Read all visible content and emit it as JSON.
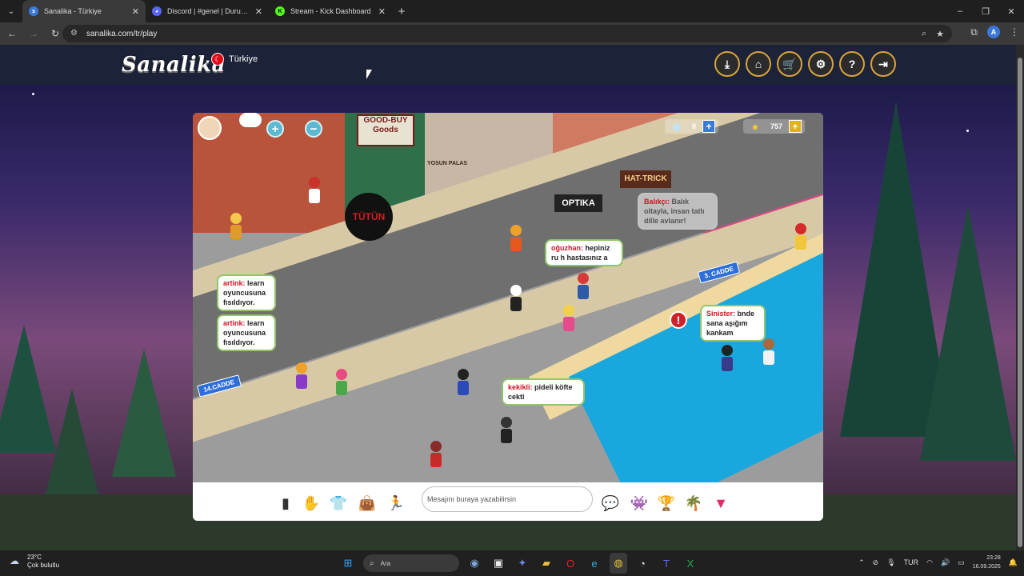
{
  "browser": {
    "tabs": [
      {
        "title": "Sanalika - Türkiye",
        "active": true,
        "favicon": "sanalika-favicon",
        "color": "#3a7ad8"
      },
      {
        "title": "Discord | #genel | Durum B",
        "active": false,
        "favicon": "discord-favicon",
        "color": "#5865f2"
      },
      {
        "title": "Stream - Kick Dashboard",
        "active": false,
        "favicon": "kick-favicon",
        "color": "#53fc18"
      }
    ],
    "new_tab": "+",
    "url": "sanalika.com/tr/play",
    "window_controls": {
      "minimize": "–",
      "maximize": "❐",
      "close": "✕"
    }
  },
  "site": {
    "logo": "Sanalika",
    "region": "Türkiye",
    "header_icons": [
      "download-icon",
      "home-icon",
      "cart-icon",
      "gear-icon",
      "help-icon",
      "logout-icon"
    ]
  },
  "game": {
    "diamonds": "0",
    "coins": "757",
    "street_signs": [
      "14.CADDE",
      "3. CADDE"
    ],
    "shop_signs": {
      "goodbuy": "GOOD-BUY Goods",
      "tutun": "TÜTÜN",
      "optika": "OPTIKA",
      "hattrick": "HAT-TRICK",
      "yosun": "YOSUN PALAS"
    },
    "chats": [
      {
        "who": "artink:",
        "text": "learn oyuncusuna fısıldıyor."
      },
      {
        "who": "artink:",
        "text": "learn oyuncusuna fısıldıyor."
      },
      {
        "who": "oğuzhan:",
        "text": "hepiniz ru h hastasınız a"
      },
      {
        "who": "Balıkçı:",
        "text": "Balık oltayla, insan tatlı dille avlanır!"
      },
      {
        "who": "Sinister:",
        "text": "bnde sana aşığım kankam"
      },
      {
        "who": "kekikli:",
        "text": "pideli köfte cekti"
      }
    ],
    "chat_placeholder": "Mesajını buraya yazabilirsin"
  },
  "taskbar": {
    "weather_temp": "23°C",
    "weather_desc": "Çok bulutlu",
    "search": "Ara",
    "lang": "TUR",
    "time": "23:28",
    "date": "16.09.2025"
  }
}
